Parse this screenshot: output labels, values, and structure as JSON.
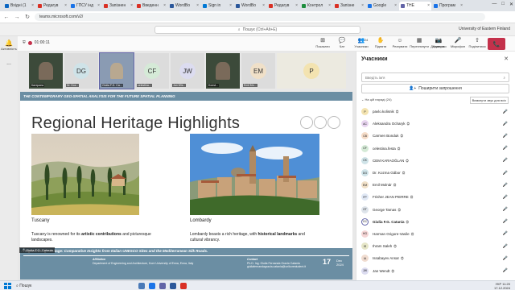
{
  "browser": {
    "tabs": [
      {
        "label": "Вхідні (1",
        "color": "#0a66c2"
      },
      {
        "label": "Редагув",
        "color": "#d93025"
      },
      {
        "label": "ГПСУ інд",
        "color": "#1a73e8"
      },
      {
        "label": "Запізнен",
        "color": "#d93025"
      },
      {
        "label": "Введенн",
        "color": "#d93025"
      },
      {
        "label": "WordBo",
        "color": "#2b579a"
      },
      {
        "label": "Sign in",
        "color": "#0078d4"
      },
      {
        "label": "WordBo",
        "color": "#2b579a"
      },
      {
        "label": "Редагув",
        "color": "#d93025"
      },
      {
        "label": "Контрол",
        "color": "#1e8e3e"
      },
      {
        "label": "Запізне",
        "color": "#d93025"
      },
      {
        "label": "Google",
        "color": "#1a73e8"
      },
      {
        "label": "THE",
        "color": "#6264a7",
        "active": true
      },
      {
        "label": "Програм",
        "color": "#1a73e8"
      }
    ],
    "url": "teams.microsoft.com/v2/",
    "window_controls": [
      "—",
      "□",
      "✕"
    ]
  },
  "teams": {
    "search_placeholder": "Пошук (Ctrl+Alt+E)",
    "org": "University of Eastern Finland",
    "rail": [
      {
        "label": "Активність",
        "icon": "bell-icon"
      },
      {
        "label": "...",
        "icon": "more-icon"
      }
    ]
  },
  "meeting": {
    "timer": "01:00:11",
    "tools": [
      {
        "label": "Показати",
        "icon": "⊞"
      },
      {
        "label": "Чат",
        "icon": "💬"
      },
      {
        "label": "Учасники",
        "icon": "👥",
        "badge": "24"
      },
      {
        "label": "Підняти",
        "icon": "✋"
      },
      {
        "label": "Реагувати",
        "icon": "☺"
      },
      {
        "label": "Переглянути",
        "icon": "▦"
      },
      {
        "label": "Додатково",
        "icon": "···"
      }
    ],
    "media": [
      {
        "label": "Камера",
        "icon": "📷"
      },
      {
        "label": "Мікрофон",
        "icon": "🎤"
      },
      {
        "label": "Поділитися",
        "icon": "⇧"
      }
    ],
    "leave_icon": "📞"
  },
  "strip": [
    {
      "type": "video",
      "name": "Катерина"
    },
    {
      "type": "initials",
      "initials": "DG",
      "name": "Dr. Koz...",
      "bg": "#cfe3e8"
    },
    {
      "type": "video-selected",
      "name": "Giulia F.G. Ca...",
      "bg": "#8a9bb3"
    },
    {
      "type": "initials",
      "initials": "CF",
      "name": "celestina...",
      "bg": "#d5ead7"
    },
    {
      "type": "initials",
      "initials": "JW",
      "name": "Jan Wis...",
      "bg": "#dcdcf0"
    },
    {
      "type": "video",
      "name": "Konst..."
    },
    {
      "type": "initials",
      "initials": "EM",
      "name": "Emil Mo...",
      "bg": "#f0e0c8"
    },
    {
      "type": "wide",
      "initials": "P",
      "name": "",
      "bg": "#f3e3b0"
    }
  ],
  "slide": {
    "top_banner": "THE CONTEMPORARY GEO-SPATIAL ANALYSIS FOR THE FUTURE SPATIAL PLANNING",
    "title": "Regional Heritage Highlights",
    "left": {
      "region": "Tuscany",
      "desc_pre": "Tuscany is renowned for its ",
      "desc_bold": "artistic contributions",
      "desc_post": " and picturesque landscapes."
    },
    "right": {
      "region": "Lombardy",
      "desc_pre": "Lombardy boasts a rich heritage, with ",
      "desc_bold": "historical landmarks",
      "desc_post": " and cultural vibrancy."
    },
    "footer": {
      "title": "Regenerating Heritage: Comparative Insights from Italian UNESCO Sites and the Mediterranean Silk Roads.",
      "affiliation_label": "Affiliation",
      "affiliation": "Department of Engineering and Architecture, Kore University of Enna, Enna, Italy",
      "contact_label": "Contact",
      "contact_name": "Ph.D. Ing. Giulia Fernanda Grazia Catania",
      "contact_email": "giuliafernandagrazia.catania@unikorestudent.it",
      "day": "17",
      "month": "Dec",
      "year": "2024"
    }
  },
  "presenter_label": "Giulia F.G. Catania",
  "panel": {
    "title": "Учасники",
    "search_placeholder": "Введіть ім'я",
    "share_invite": "Поширити запрошення",
    "section": "На цій нараді (24)",
    "mute_all": "Вимкнути звук для всіх",
    "participants": [
      {
        "initials": "P",
        "name": "pavlo.kolisnik",
        "bg": "#f3e3b0"
      },
      {
        "initials": "AC",
        "name": "Aleksandra Ocharyk",
        "bg": "#e8d5f0"
      },
      {
        "initials": "CB",
        "name": "Carmen Bonduk",
        "bg": "#f5dcc8"
      },
      {
        "initials": "CF",
        "name": "celestina.festa",
        "bg": "#d5ead7"
      },
      {
        "initials": "CK",
        "name": "CEM KARAOĞLAN",
        "bg": "#cfe3e8"
      },
      {
        "initials": "DG",
        "name": "Dr. Kozma Gábor",
        "bg": "#cfe3e8"
      },
      {
        "initials": "EM",
        "name": "Emil Molnár",
        "bg": "#f0e0c8"
      },
      {
        "initials": "FP",
        "name": "Frisher JEAN PIERRE",
        "bg": "#e0e8f5"
      },
      {
        "initials": "GT",
        "name": "George Tamas",
        "bg": "#dde3ea"
      },
      {
        "initials": "GC",
        "name": "Giulia F.G. Catania",
        "bg": "#ffffff",
        "bold": true
      },
      {
        "initials": "HG",
        "name": "Harman Grigore-Vasile",
        "bg": "#f5d5d5"
      },
      {
        "initials": "IS",
        "name": "Ihram Saleh",
        "bg": "#e6e6c8"
      },
      {
        "initials": "IA",
        "name": "Issabayev Ansar",
        "bg": "#f0dcd0"
      },
      {
        "initials": "JW",
        "name": "Jan Wendt",
        "bg": "#dcdcf0"
      }
    ]
  },
  "taskbar": {
    "search": "Пошук",
    "lang": "УКР",
    "time": "11:20",
    "date": "17.12.2024"
  }
}
